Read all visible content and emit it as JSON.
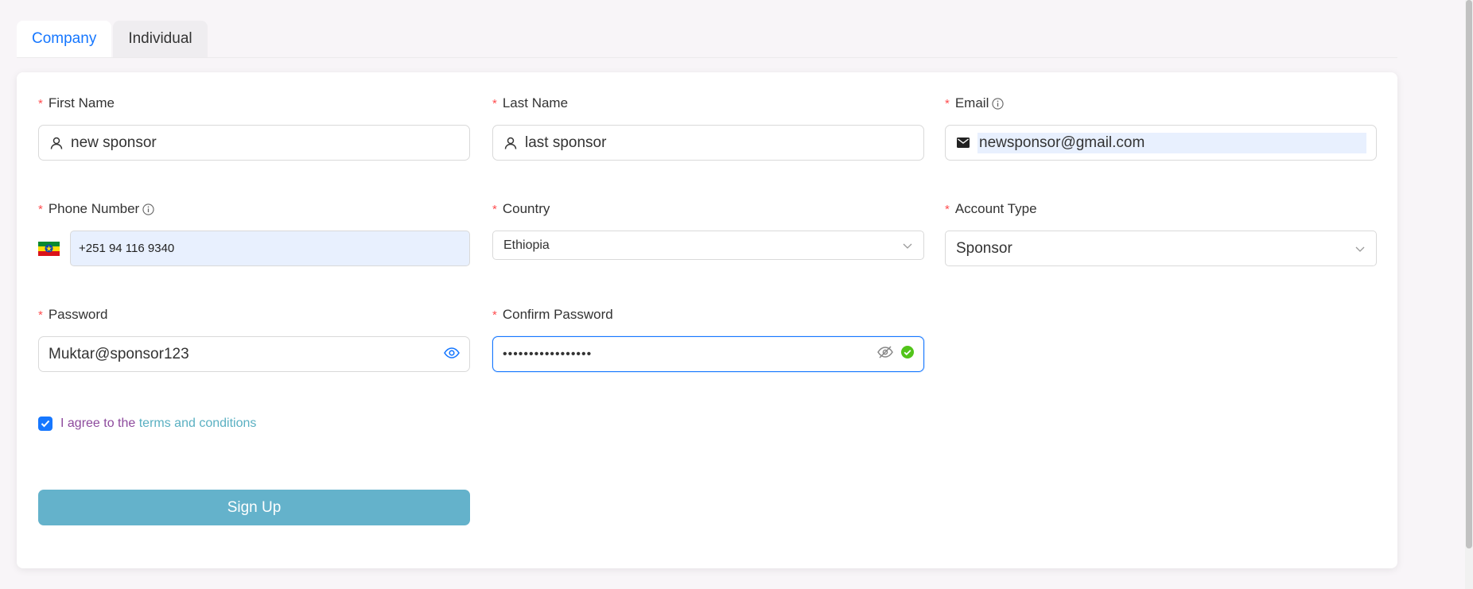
{
  "tabs": [
    {
      "label": "Company",
      "active": true
    },
    {
      "label": "Individual",
      "active": false
    }
  ],
  "form": {
    "first_name": {
      "label": "First Name",
      "value": "new sponsor",
      "icon": "user-icon"
    },
    "last_name": {
      "label": "Last Name",
      "value": "last sponsor",
      "icon": "user-icon"
    },
    "email": {
      "label": "Email",
      "value": "newsponsor@gmail.com",
      "icon": "mail-icon"
    },
    "phone": {
      "label": "Phone Number",
      "value": "+251 94 116 9340",
      "flag": "ethiopia-flag-icon"
    },
    "country": {
      "label": "Country",
      "value": "Ethiopia"
    },
    "account_type": {
      "label": "Account Type",
      "value": "Sponsor"
    },
    "password": {
      "label": "Password",
      "value": "Muktar@sponsor123"
    },
    "confirm_password": {
      "label": "Confirm Password",
      "value": "•••••••••••••••••"
    }
  },
  "agree": {
    "prefix": "I agree to the ",
    "link": "terms and conditions",
    "checked": true
  },
  "submit_label": "Sign Up",
  "colors": {
    "accent": "#1677ff",
    "button": "#64b2cb",
    "required": "#ff4d4f",
    "success": "#52c41a"
  }
}
